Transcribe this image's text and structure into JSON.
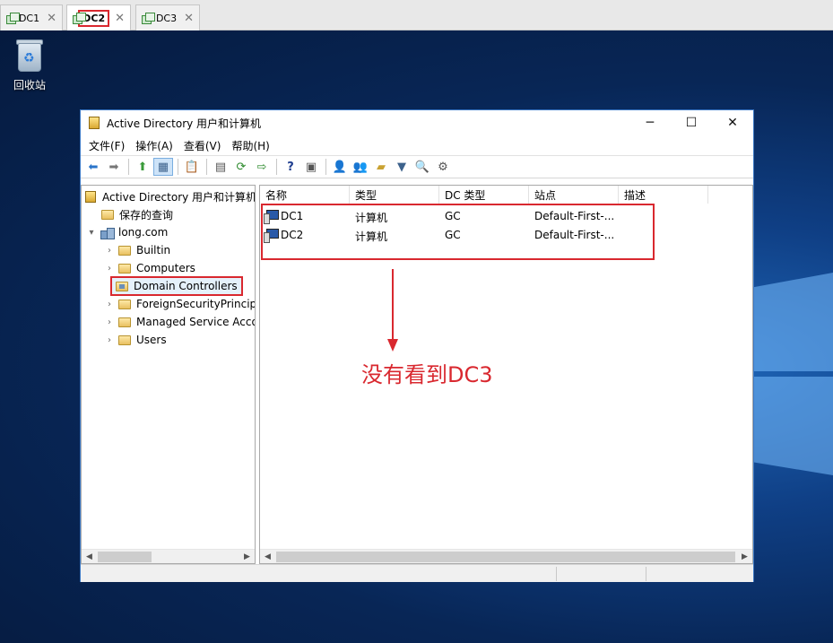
{
  "vm_tabs": [
    {
      "label": "DC1",
      "active": false
    },
    {
      "label": "DC2",
      "active": true
    },
    {
      "label": "DC3",
      "active": false
    }
  ],
  "desktop": {
    "recycle_bin_label": "回收站"
  },
  "window": {
    "title": "Active Directory 用户和计算机",
    "menu": [
      "文件(F)",
      "操作(A)",
      "查看(V)",
      "帮助(H)"
    ]
  },
  "tree": {
    "root": "Active Directory 用户和计算机",
    "saved_queries": "保存的查询",
    "domain": "long.com",
    "children": [
      "Builtin",
      "Computers",
      "Domain Controllers",
      "ForeignSecurityPrincipa",
      "Managed Service Acco",
      "Users"
    ]
  },
  "list": {
    "columns": [
      "名称",
      "类型",
      "DC 类型",
      "站点",
      "描述"
    ],
    "rows": [
      {
        "name": "DC1",
        "type": "计算机",
        "dc_type": "GC",
        "site": "Default-First-...",
        "description": ""
      },
      {
        "name": "DC2",
        "type": "计算机",
        "dc_type": "GC",
        "site": "Default-First-...",
        "description": ""
      }
    ]
  },
  "annotation": {
    "text": "没有看到DC3",
    "color": "#d9282f"
  },
  "icons": {
    "vm_tab": "vm-icon",
    "recycle_bin": "recycle-bin-icon",
    "computer": "computer-icon",
    "folder": "folder-icon",
    "domain": "domain-icon"
  }
}
